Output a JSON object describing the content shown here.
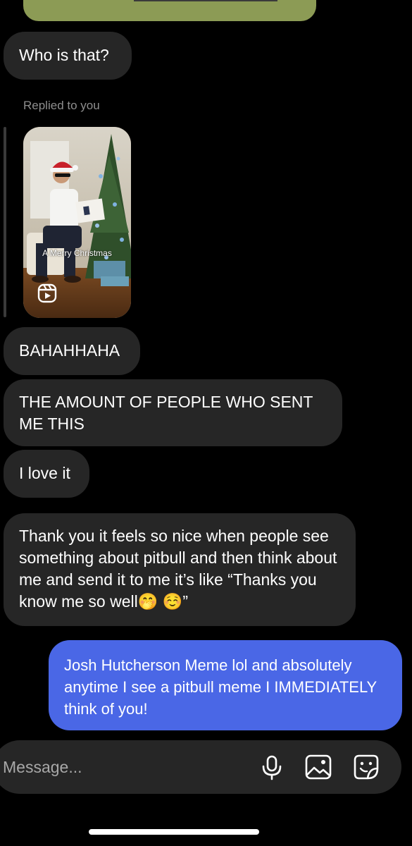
{
  "thread": {
    "received_1": "Who is that?",
    "reply_context": "Replied to you",
    "reel_caption": "A Merry Christmas",
    "received_2": "BAHAHHAHA",
    "received_3": "THE AMOUNT OF PEOPLE WHO SENT ME THIS",
    "received_4": "I love it",
    "received_5": "Thank you it feels so nice when people see something about pitbull and then think about me and send it to me it’s like “Thanks you know me so well🤭 ☺️”",
    "sent_1": "Josh Hutcherson Meme lol and absolutely anytime I see a pitbull meme I IMMEDIATELY think of you!"
  },
  "composer": {
    "placeholder": "Message..."
  },
  "icons": {
    "reel": "reels-icon",
    "mic": "microphone-icon",
    "gallery": "image-icon",
    "sticker": "sticker-icon"
  },
  "colors": {
    "background": "#000000",
    "received_bubble": "#262626",
    "sent_bubble": "#4a67e6",
    "muted_text": "#8e8e8e"
  }
}
